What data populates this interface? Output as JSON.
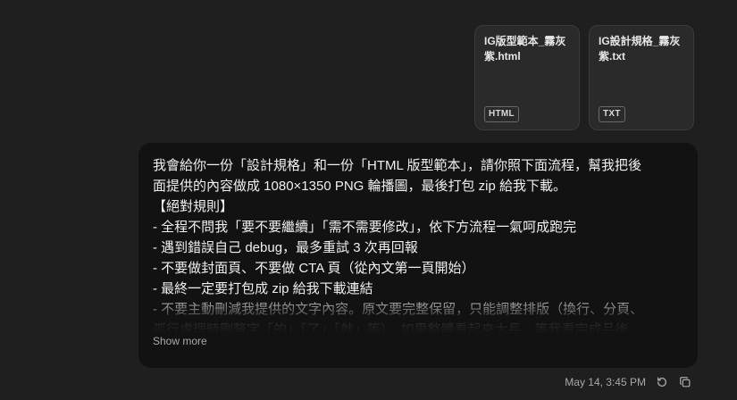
{
  "attachments": [
    {
      "name": "IG版型範本_霧灰紫.html",
      "type": "HTML"
    },
    {
      "name": "IG設計規格_霧灰紫.txt",
      "type": "TXT"
    }
  ],
  "message": {
    "lines": [
      "我會給你一份「設計規格」和一份「HTML 版型範本」，請你照下面流程，幫我把後",
      "面提供的內容做成 1080×1350 PNG 輪播圖，最後打包 zip 給我下載。",
      "【絕對規則】",
      "- 全程不問我「要不要繼續」「需不需要修改」，依下方流程一氣呵成跑完",
      "- 遇到錯誤自己 debug，最多重試 3 次再回報",
      "- 不要做封面頁、不要做 CTA 頁（從內文第一頁開始）",
      "- 最終一定要打包成 zip 給我下載連結",
      "- 不要主動刪減我提供的文字內容。原文要完整保留，只能調整排版（換行、分頁、",
      "孤行處理時刪贅字「的」「了」「就」等）。如果整體看起來太長，等我看完成品後"
    ],
    "show_more_label": "Show more"
  },
  "footer": {
    "timestamp": "May 14, 3:45 PM",
    "retry_icon": "retry-icon",
    "copy_icon": "copy-icon"
  }
}
